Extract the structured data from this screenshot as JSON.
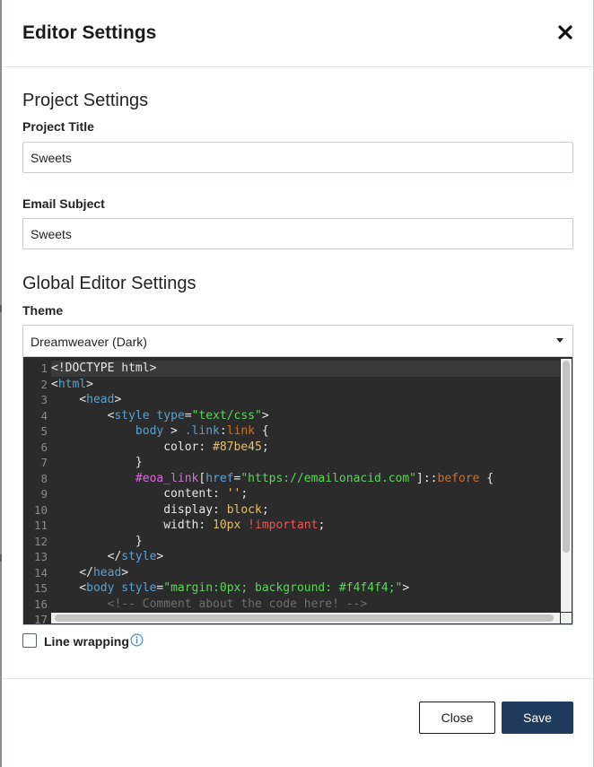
{
  "modal": {
    "title": "Editor Settings"
  },
  "project_settings": {
    "heading": "Project Settings",
    "project_title_label": "Project Title",
    "project_title_value": "Sweets",
    "email_subject_label": "Email Subject",
    "email_subject_value": "Sweets"
  },
  "global_settings": {
    "heading": "Global Editor Settings",
    "theme_label": "Theme",
    "theme_value": "Dreamweaver (Dark)"
  },
  "code_editor": {
    "line_numbers": [
      "1",
      "2",
      "3",
      "4",
      "5",
      "6",
      "7",
      "8",
      "9",
      "10",
      "11",
      "12",
      "13",
      "14",
      "15",
      "16",
      "17"
    ]
  },
  "line_wrapping": {
    "label": "Line wrapping",
    "checked": false
  },
  "footer": {
    "close_label": "Close",
    "save_label": "Save"
  },
  "colors": {
    "primary_button": "#1e3a5c",
    "editor_background": "#2b2b2b"
  },
  "icons": {
    "close": "close-icon",
    "dropdown": "caret-down-icon",
    "info": "info-icon"
  }
}
